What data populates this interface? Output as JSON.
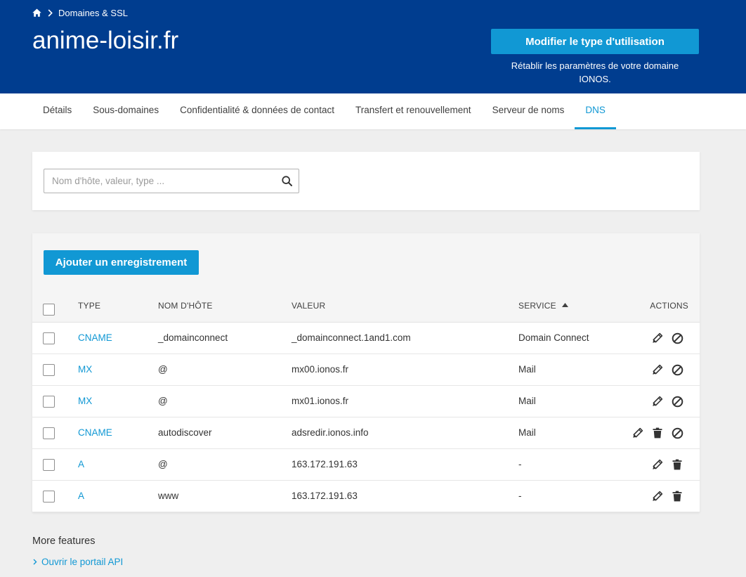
{
  "breadcrumb": {
    "home_icon": "home-icon",
    "separator_icon": "chevron-right-icon",
    "items": [
      {
        "label": "Domaines & SSL"
      }
    ]
  },
  "header": {
    "title": "anime-loisir.fr",
    "change_usage_button": "Modifier le type d'utilisation",
    "reset_text": "Rétablir les paramètres de votre domaine IONOS."
  },
  "tabs": [
    {
      "label": "Détails",
      "active": false
    },
    {
      "label": "Sous-domaines",
      "active": false
    },
    {
      "label": "Confidentialité & données de contact",
      "active": false
    },
    {
      "label": "Transfert et renouvellement",
      "active": false
    },
    {
      "label": "Serveur de noms",
      "active": false
    },
    {
      "label": "DNS",
      "active": true
    }
  ],
  "search": {
    "placeholder": "Nom d'hôte, valeur, type ...",
    "value": "",
    "icon": "search-icon"
  },
  "records": {
    "add_button": "Ajouter un enregistrement",
    "columns": {
      "type": "TYPE",
      "host": "NOM D'HÔTE",
      "value": "VALEUR",
      "service": "SERVICE",
      "actions": "ACTIONS"
    },
    "sort_icon": "sort-ascending-icon",
    "rows": [
      {
        "type": "CNAME",
        "host": "_domainconnect",
        "value": "_domainconnect.1and1.com",
        "service": "Domain Connect",
        "checked": false,
        "actions": [
          "pencil-icon",
          "block-icon"
        ]
      },
      {
        "type": "MX",
        "host": "@",
        "value": "mx00.ionos.fr",
        "service": "Mail",
        "checked": false,
        "actions": [
          "pencil-icon",
          "block-icon"
        ]
      },
      {
        "type": "MX",
        "host": "@",
        "value": "mx01.ionos.fr",
        "service": "Mail",
        "checked": false,
        "actions": [
          "pencil-icon",
          "block-icon"
        ]
      },
      {
        "type": "CNAME",
        "host": "autodiscover",
        "value": "adsredir.ionos.info",
        "service": "Mail",
        "checked": false,
        "actions": [
          "pencil-icon",
          "trash-icon",
          "block-icon"
        ]
      },
      {
        "type": "A",
        "host": "@",
        "value": "163.172.191.63",
        "service": "-",
        "checked": false,
        "actions": [
          "pencil-icon",
          "trash-icon"
        ]
      },
      {
        "type": "A",
        "host": "www",
        "value": "163.172.191.63",
        "service": "-",
        "checked": false,
        "actions": [
          "pencil-icon",
          "trash-icon"
        ]
      }
    ]
  },
  "more_features": {
    "title": "More features",
    "links": [
      {
        "label": "Ouvrir le portail API",
        "icon": "chevron-right-icon"
      }
    ]
  },
  "colors": {
    "header_bg": "#003d8f",
    "primary": "#1198d4",
    "link": "#1198d4",
    "page_bg": "#efefef",
    "text": "#333333"
  }
}
